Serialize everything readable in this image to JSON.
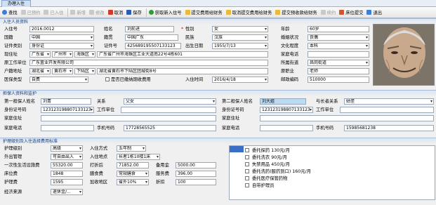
{
  "tab": {
    "label": "办理入住"
  },
  "toolbar": {
    "search": "查找",
    "prev": "已预约",
    "checked_in": "已入住",
    "new": "新增",
    "edit": "修改",
    "cancel": "取消",
    "save": "保存",
    "get_new_id": "获取新入住号",
    "submit_fee": "提交费用给财务",
    "cancel_submit_fee": "取消提交费用给财务",
    "submit_deposit": "提交预收款给财务",
    "renew": "续约",
    "submit_bed": "床位提交",
    "exit": "退出"
  },
  "resident": {
    "section": "入住人员资料",
    "id_no_label": "入住号",
    "id_no": "2016.0012",
    "name_label": "姓名",
    "name": "刘前进",
    "gender_label": "性别",
    "gender": "女",
    "age_label": "年龄",
    "age": "60岁",
    "nation_label": "国籍",
    "nation": "中国",
    "origin_label": "籍贯",
    "origin": "中国广东",
    "ethnic_label": "民族",
    "ethnic": "汉族",
    "marital_label": "婚姻状况",
    "marital": "丧偶",
    "cert_type_label": "证件类别",
    "cert_type": "身份证",
    "cert_no_label": "证件号",
    "cert_no": "425689195507133123",
    "birth_label": "出生日期",
    "birth": "1955/7/13",
    "edu_label": "文化程度",
    "edu": "本科",
    "addr_label": "现住址",
    "addr_prov": "广东省",
    "addr_city": "广州市",
    "addr_dist": "海珠区",
    "addr_detail": "广东省广州市海珠区工业大道南22号4栋601",
    "home_phone_label": "家庭电话",
    "home_phone": "",
    "work_label": "原工作单位",
    "work": "广东置业开发有限公司",
    "street_label": "所属街道",
    "street": "昌岗街道",
    "hukou_label": "户籍地址",
    "hukou_prov": "湖北省",
    "hukou_city": "黄石市",
    "hukou_dist": "下陆区",
    "hukou_detail": "湖北省黄石市下陆区团城街8号",
    "job_label": "原职业",
    "job": "老师",
    "med_label": "医保类型",
    "med": "自费",
    "expired_label": "是否已缴纳期收费用",
    "in_date_label": "入住时间",
    "in_date": "2016/4/18",
    "zip_label": "邮政编码",
    "zip": "510000"
  },
  "guardian": {
    "section": "担保人资料和监护",
    "g1_label": "第一担保人姓名",
    "g1": "刘青",
    "g1_rel_label": "关系",
    "g1_rel": "父女",
    "g1_id_label": "身份证号码",
    "g1_id": "123123198807133123",
    "g1_work_label": "工作单位",
    "g1_work": "",
    "g1_addr_label": "家庭住址",
    "g1_addr": "",
    "g1_phone_label": "家庭电话",
    "g1_phone": "",
    "g1_mobile_label": "手机号码",
    "g1_mobile": "17728565525",
    "g2_label": "第二担保人姓名",
    "g2": "刘大姐",
    "g2_rel_label": "与长者关系",
    "g2_rel": "姑侄",
    "g2_id_label": "身份证号码",
    "g2_id": "123123198807133123",
    "g2_work_label": "工作单位",
    "g2_work": "",
    "g2_addr_label": "家庭住址",
    "g2_addr": "",
    "g2_phone_label": "家庭电话",
    "g2_phone": "",
    "g2_mobile_label": "手机号码",
    "g2_mobile": "15985681238"
  },
  "fees": {
    "section": "护理级别及入住选择费用标准",
    "care_level_label": "护理级别",
    "care_level": "高级",
    "care_type_label": "入住方式",
    "care_type": "五年制",
    "out_label": "外出管理",
    "out": "可自由出入",
    "room_label": "入住地点",
    "room": "长者1栋10楼1床",
    "once_fee_label": "一次性生活设施费",
    "once_fee": "55320.00",
    "discount_label": "打折后",
    "discount": "71852.00",
    "reserve_label": "备用金",
    "reserve": "5000.00",
    "bed_fee_label": "床位费",
    "bed_fee": "1848",
    "meal_label": "膳食费",
    "meal": "常规膳食",
    "service_label": "服务费",
    "service": "396.00",
    "care_fee_label": "护理费",
    "care_fee": "1595",
    "extra_label": "加收地区",
    "extra": "省外10%",
    "rebate_label": "折扣",
    "rebate": "100",
    "source_label": "经济来源",
    "source": "退休金/...",
    "packages": [
      "委托探药 130元/月",
      "委托洗衣 90元/月",
      "失禁用品 450元/月",
      "委托洗药(服药到口) 160元/月",
      "委托医疗保管药物",
      "自带护理员"
    ]
  }
}
